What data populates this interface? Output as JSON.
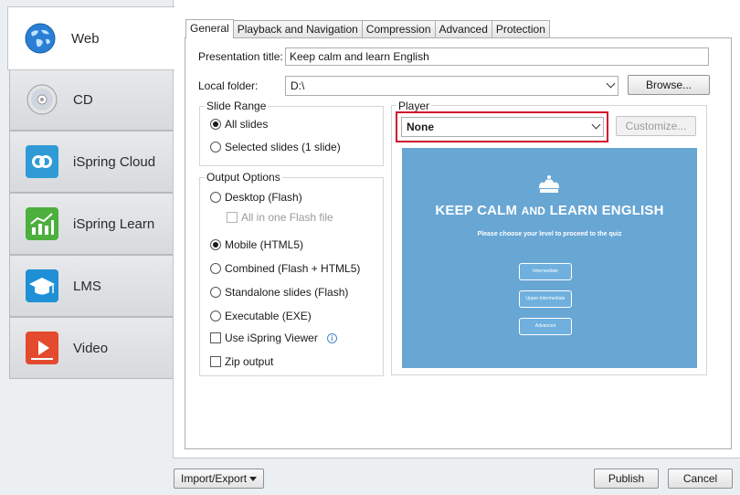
{
  "sidebar": {
    "items": [
      {
        "label": "Web",
        "icon": "globe-icon",
        "color": "#2a7fd4"
      },
      {
        "label": "CD",
        "icon": "cd-icon",
        "color": "#c9c9c9"
      },
      {
        "label": "iSpring Cloud",
        "icon": "cloud-link-icon",
        "color": "#2e9bd6"
      },
      {
        "label": "iSpring Learn",
        "icon": "chart-growth-icon",
        "color": "#4caf3e"
      },
      {
        "label": "LMS",
        "icon": "graduation-cap-icon",
        "color": "#1f8fd6"
      },
      {
        "label": "Video",
        "icon": "play-icon",
        "color": "#e34a2e"
      }
    ]
  },
  "tabs": [
    "General",
    "Playback and Navigation",
    "Compression",
    "Advanced",
    "Protection"
  ],
  "general": {
    "presentation_title_label": "Presentation title:",
    "presentation_title_value": "Keep calm and learn English",
    "local_folder_label": "Local folder:",
    "local_folder_value": "D:\\",
    "browse_label": "Browse..."
  },
  "slide_range": {
    "title": "Slide Range",
    "options": [
      "All slides",
      "Selected slides (1 slide)"
    ],
    "selected": 0
  },
  "output_options": {
    "title": "Output Options",
    "desktop": "Desktop (Flash)",
    "all_in_one": "All in one Flash file",
    "mobile": "Mobile (HTML5)",
    "combined": "Combined (Flash + HTML5)",
    "standalone": "Standalone slides (Flash)",
    "executable": "Executable (EXE)",
    "use_viewer": "Use iSpring Viewer",
    "zip": "Zip output",
    "selected": "mobile"
  },
  "player": {
    "title": "Player",
    "value": "None",
    "customize_label": "Customize...",
    "highlight_color": "#d0142c"
  },
  "preview": {
    "title_big1": "KEEP CALM",
    "title_small": "AND",
    "title_big2": "LEARN ENGLISH",
    "subtitle": "Please choose your level to proceed to the quiz",
    "buttons": [
      "Intermediate",
      "Upper-Intermediate",
      "Advanced"
    ],
    "bg_color": "#68a6d4"
  },
  "footer": {
    "import_export": "Import/Export",
    "publish": "Publish",
    "cancel": "Cancel"
  }
}
